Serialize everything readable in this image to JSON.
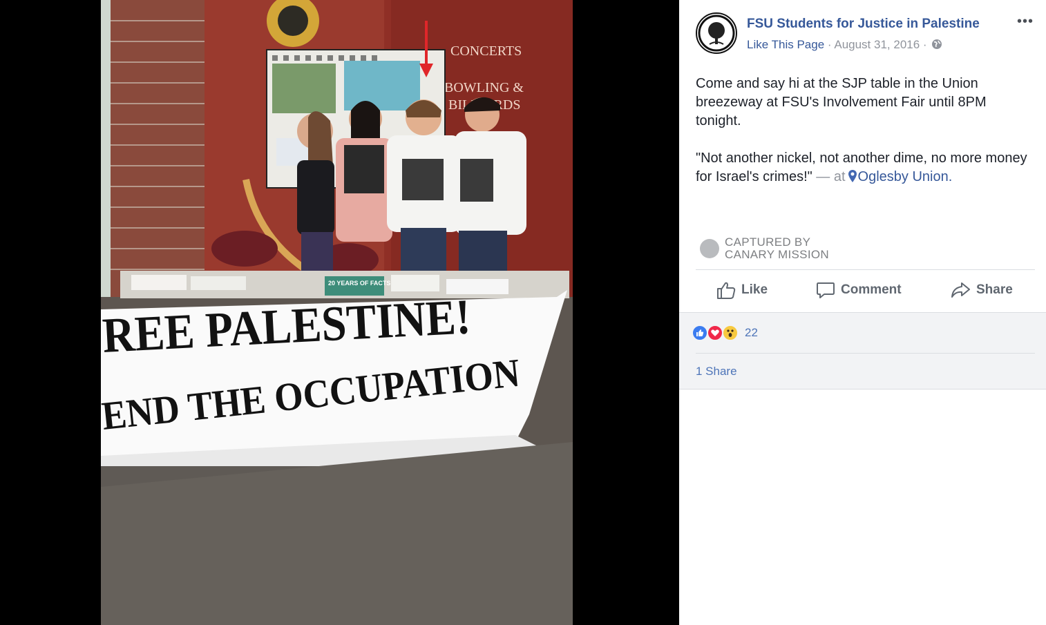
{
  "post": {
    "page_name": "FSU Students for Justice in Palestine",
    "like_page": "Like This Page",
    "separator": "·",
    "date": "August 31, 2016",
    "body_paragraph_1": "Come and say hi at the SJP table in the Union breezeway at FSU's Involvement Fair until 8PM tonight.",
    "body_paragraph_2": "\"Not another nickel, not another dime, no more money for Israel's crimes!\"",
    "at_text": "— at",
    "place": "Oglesby Union.",
    "more_icon": "ellipsis-icon",
    "privacy_icon": "globe-icon"
  },
  "watermark": {
    "line1": "CAPTURED BY",
    "line2": "CANARY MISSION"
  },
  "actions": {
    "like": "Like",
    "comment": "Comment",
    "share": "Share"
  },
  "engagement": {
    "reaction_count": "22",
    "reactions": [
      "like",
      "love",
      "wow"
    ],
    "shares": "1 Share"
  },
  "photo": {
    "banner_line_1": "REE PALESTINE!",
    "banner_line_2": "END THE OCCUPATION",
    "building_sign_1": "CONCERTS",
    "building_sign_2": "BOWLING &",
    "building_sign_3": "BILLIARDS",
    "book_label": "20 YEARS OF FACTS"
  },
  "colors": {
    "link": "#365899",
    "meta": "#90949c",
    "text": "#1d2129",
    "arrow": "#e0262a"
  }
}
